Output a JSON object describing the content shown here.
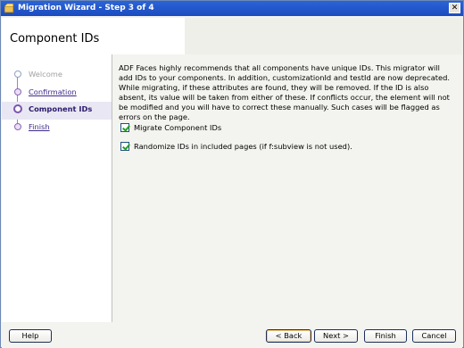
{
  "window": {
    "title": "Migration Wizard - Step 3 of 4",
    "close_glyph": "✕"
  },
  "header": {
    "title": "Component IDs"
  },
  "steps": [
    {
      "label": "Welcome",
      "state": "disabled"
    },
    {
      "label": "Confirmation",
      "state": "link"
    },
    {
      "label": "Component IDs",
      "state": "current"
    },
    {
      "label": "Finish",
      "state": "link"
    }
  ],
  "content": {
    "description": "ADF Faces highly recommends that all components have unique IDs. This migrator will add IDs to your components. In addition, customizationId and testId are now deprecated. While migrating, if these attributes are found, they will be removed. If the ID is also absent, its value will be taken from either of these. If conflicts occur, the element will not be modified and you will have to correct these manually. Such cases will be flagged as errors on the page.",
    "options": [
      {
        "label": "Migrate Component IDs",
        "checked": true
      },
      {
        "label": "Randomize IDs in included pages (if f:subview is not used).",
        "checked": true
      }
    ]
  },
  "footer": {
    "help": "Help",
    "back": "< Back",
    "next": "Next >",
    "finish": "Finish",
    "cancel": "Cancel"
  }
}
